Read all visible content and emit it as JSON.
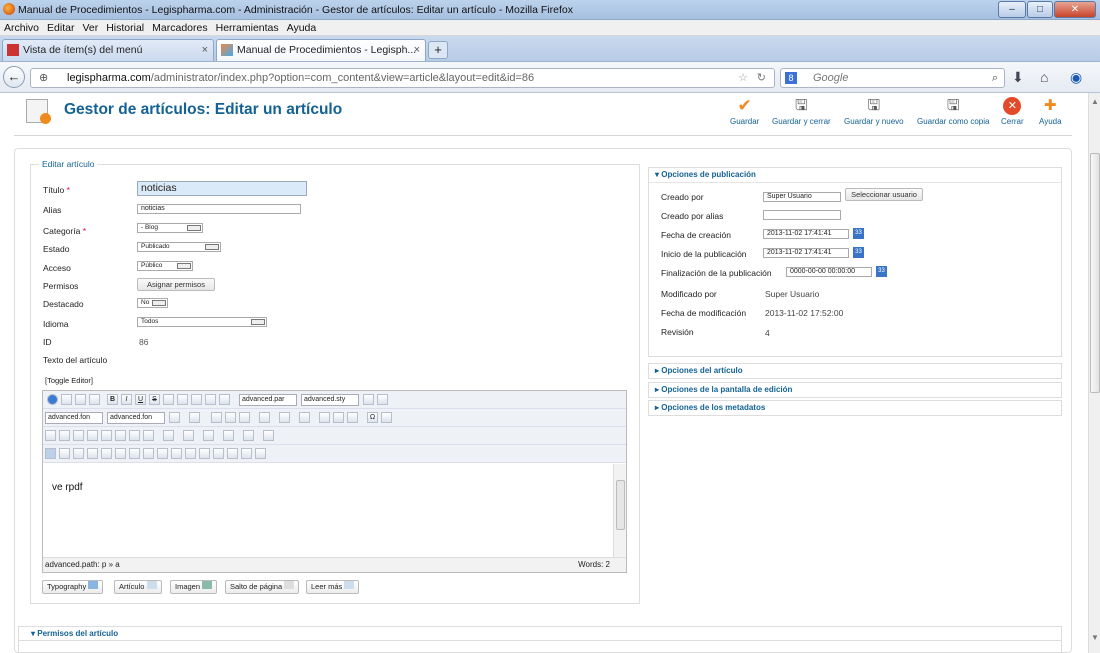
{
  "window": {
    "title": "Manual de Procedimientos - Legispharma.com - Administración - Gestor de artículos: Editar un artículo - Mozilla Firefox"
  },
  "menu": [
    "Archivo",
    "Editar",
    "Ver",
    "Historial",
    "Marcadores",
    "Herramientas",
    "Ayuda"
  ],
  "tabs": [
    {
      "label": "Vista de ítem(s) del menú"
    },
    {
      "label": "Manual de Procedimientos - Legisph..."
    }
  ],
  "nav": {
    "url_host": "legispharma.com",
    "url_path": "/administrator/index.php?option=com_content&view=article&layout=edit&id=86",
    "search_placeholder": "Google"
  },
  "toolbar": {
    "title": "Gestor de artículos: Editar un artículo",
    "buttons": [
      {
        "label": "Guardar",
        "icon": "check-icon"
      },
      {
        "label": "Guardar y cerrar",
        "icon": "save-close-icon"
      },
      {
        "label": "Guardar y nuevo",
        "icon": "save-new-icon"
      },
      {
        "label": "Guardar como copia",
        "icon": "save-copy-icon"
      },
      {
        "label": "Cerrar",
        "icon": "close-icon"
      },
      {
        "label": "Ayuda",
        "icon": "help-icon"
      }
    ]
  },
  "form": {
    "legend": "Editar artículo",
    "title_label": "Título",
    "title_value": "noticias",
    "alias_label": "Alias",
    "alias_value": "noticias",
    "category_label": "Categoría",
    "category_value": "- Blog",
    "state_label": "Estado",
    "state_value": "Publicado",
    "access_label": "Acceso",
    "access_value": "Público",
    "perms_label": "Permisos",
    "perms_button": "Asignar permisos",
    "featured_label": "Destacado",
    "featured_value": "No",
    "language_label": "Idioma",
    "language_value": "Todos",
    "id_label": "ID",
    "id_value": "86",
    "text_label": "Texto del artículo",
    "toggle": "[Toggle Editor]"
  },
  "editor": {
    "style_select_1": "advanced.par",
    "style_select_2": "advanced.sty",
    "font_select_1": "advanced.fon",
    "font_select_2": "advanced.fon",
    "content": "ve rpdf",
    "path": "advanced.path: p » a",
    "words": "Words: 2",
    "buttons": [
      "Typography",
      "Artículo",
      "Imagen",
      "Salto de página",
      "Leer más"
    ]
  },
  "publish": {
    "header": "Opciones de publicación",
    "created_by_label": "Creado por",
    "created_by_value": "Super Usuario",
    "select_user_button": "Seleccionar usuario",
    "created_alias_label": "Creado por alias",
    "created_date_label": "Fecha de creación",
    "created_date_value": "2013-11-02 17:41:41",
    "publish_up_label": "Inicio de la publicación",
    "publish_up_value": "2013-11-02 17:41:41",
    "publish_down_label": "Finalización de la publicación",
    "publish_down_value": "0000-00-00 00:00:00",
    "modified_by_label": "Modificado por",
    "modified_by_value": "Super Usuario",
    "modified_date_label": "Fecha de modificación",
    "modified_date_value": "2013-11-02 17:52:00",
    "revision_label": "Revisión",
    "revision_value": "4"
  },
  "collapsed_panels": [
    "Opciones del artículo",
    "Opciones de la pantalla de edición",
    "Opciones de los metadatos"
  ],
  "permissions_header": "Permisos del artículo",
  "colors": {
    "accent": "#146295",
    "required": "#e03",
    "save": "#f08a1c"
  }
}
